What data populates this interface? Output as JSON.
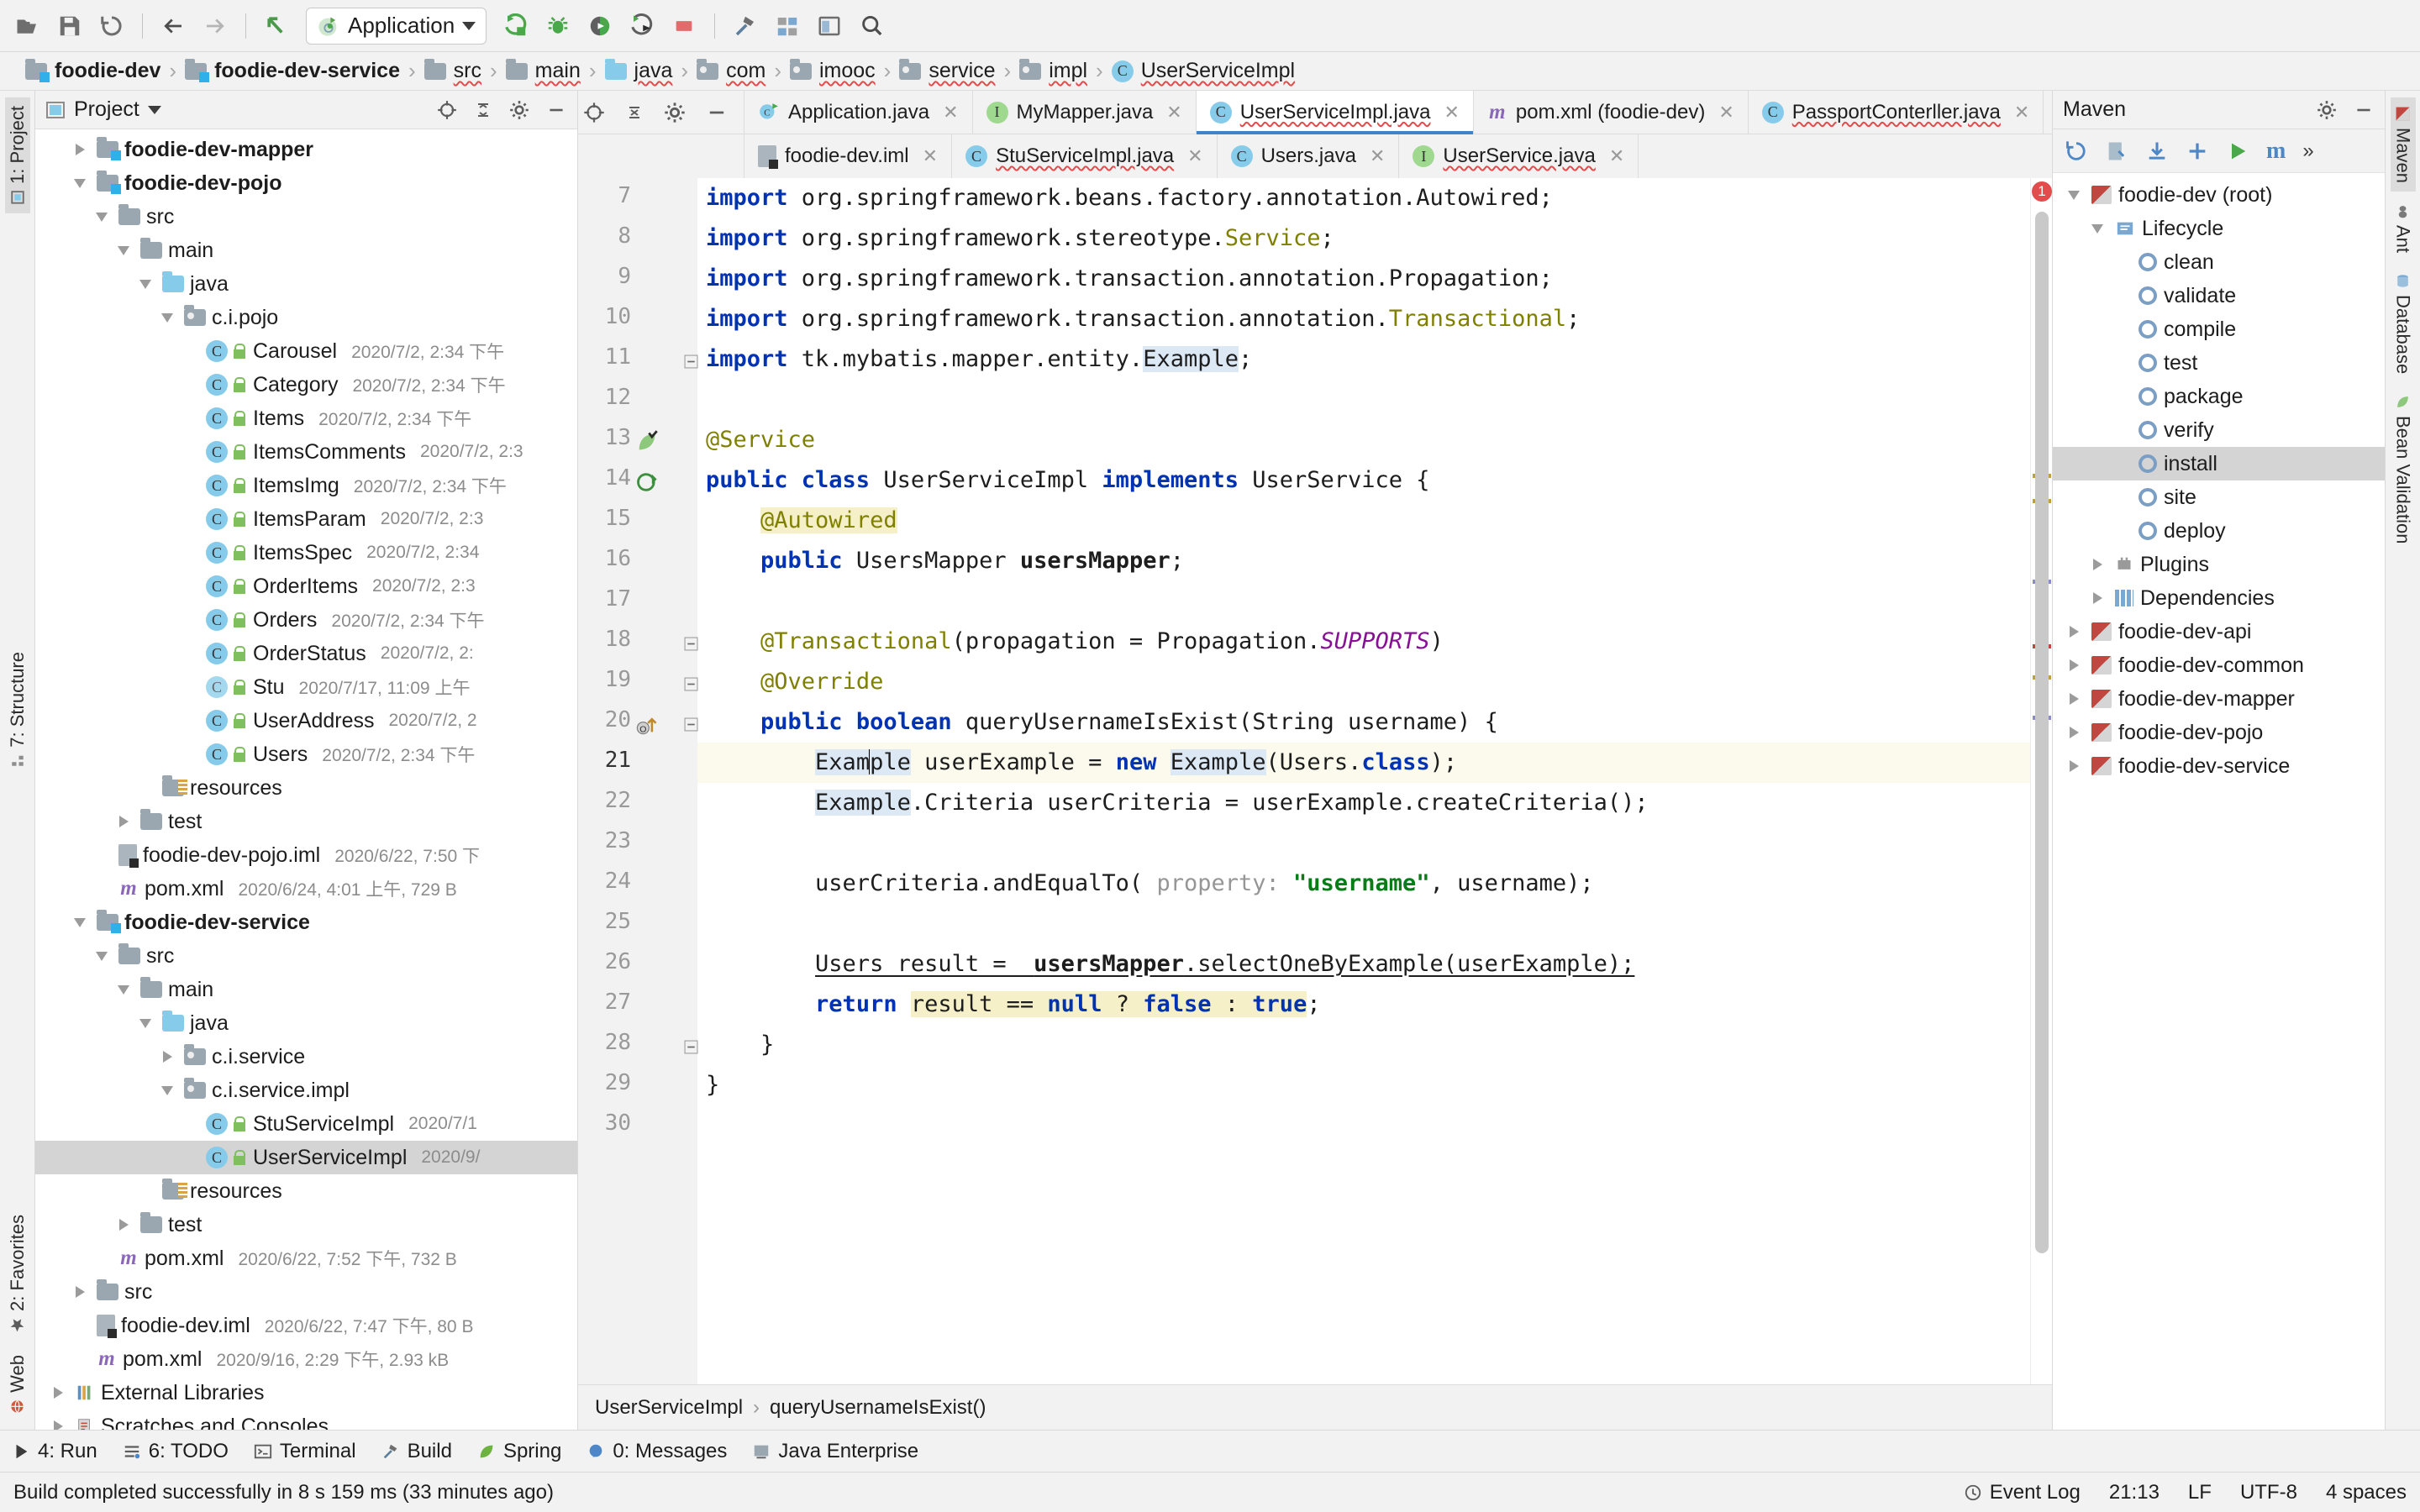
{
  "toolbar": {
    "buttons": [
      "open-folder",
      "save-all",
      "sync",
      "back",
      "forward",
      "jump-to-source"
    ],
    "run_config": {
      "label": "Application",
      "dropdown": "▾"
    },
    "right_buttons": [
      "run",
      "debug",
      "run-with-coverage",
      "profile",
      "stop",
      "build",
      "settings",
      "structure",
      "preview",
      "search"
    ]
  },
  "breadcrumb": {
    "items": [
      {
        "label": "foodie-dev",
        "icon": "module-folder-icon",
        "bold": true,
        "spell": false
      },
      {
        "label": "foodie-dev-service",
        "icon": "module-folder-icon",
        "bold": true,
        "spell": false
      },
      {
        "label": "src",
        "icon": "folder-icon",
        "bold": false,
        "spell": true
      },
      {
        "label": "main",
        "icon": "folder-icon",
        "bold": false,
        "spell": true
      },
      {
        "label": "java",
        "icon": "source-folder-icon",
        "bold": false,
        "spell": true
      },
      {
        "label": "com",
        "icon": "package-icon",
        "bold": false,
        "spell": true
      },
      {
        "label": "imooc",
        "icon": "package-icon",
        "bold": false,
        "spell": true
      },
      {
        "label": "service",
        "icon": "package-icon",
        "bold": false,
        "spell": true
      },
      {
        "label": "impl",
        "icon": "package-icon",
        "bold": false,
        "spell": true
      },
      {
        "label": "UserServiceImpl",
        "icon": "class-icon",
        "bold": false,
        "spell": true
      }
    ],
    "separator": "›"
  },
  "left_rail": {
    "top": [
      {
        "label": "1: Project",
        "icon": "project-icon",
        "selected": true
      }
    ],
    "middle": [
      {
        "label": "7: Structure",
        "icon": "structure-icon",
        "selected": false
      }
    ],
    "bottom": [
      {
        "label": "2: Favorites",
        "icon": "star-icon",
        "selected": false
      },
      {
        "label": "Web",
        "icon": "web-icon",
        "selected": false
      }
    ]
  },
  "project_panel": {
    "title": "Project",
    "dropdown": "▾",
    "header_icons": [
      "locate-icon",
      "collapse-all-icon",
      "settings-icon",
      "hide-icon"
    ],
    "tree": [
      {
        "indent": 1,
        "tw": "right",
        "icon": "module-folder-icon",
        "label": "foodie-dev-mapper",
        "bold": true,
        "meta": "",
        "sel": false
      },
      {
        "indent": 1,
        "tw": "down",
        "icon": "module-folder-icon",
        "label": "foodie-dev-pojo",
        "bold": true,
        "meta": "",
        "sel": false
      },
      {
        "indent": 2,
        "tw": "down",
        "icon": "folder-icon",
        "label": "src",
        "bold": false,
        "meta": "",
        "sel": false
      },
      {
        "indent": 3,
        "tw": "down",
        "icon": "folder-icon",
        "label": "main",
        "bold": false,
        "meta": "",
        "sel": false
      },
      {
        "indent": 4,
        "tw": "down",
        "icon": "source-folder-icon",
        "label": "java",
        "bold": false,
        "meta": "",
        "sel": false
      },
      {
        "indent": 5,
        "tw": "down",
        "icon": "package-icon",
        "label": "c.i.pojo",
        "bold": false,
        "meta": "",
        "sel": false
      },
      {
        "indent": 6,
        "tw": "none",
        "icon": "class-icon",
        "lock": true,
        "label": "Carousel",
        "bold": false,
        "meta": "2020/7/2, 2:34 下午",
        "sel": false
      },
      {
        "indent": 6,
        "tw": "none",
        "icon": "class-icon",
        "lock": true,
        "label": "Category",
        "bold": false,
        "meta": "2020/7/2, 2:34 下午",
        "sel": false
      },
      {
        "indent": 6,
        "tw": "none",
        "icon": "class-icon",
        "lock": true,
        "label": "Items",
        "bold": false,
        "meta": "2020/7/2, 2:34 下午",
        "sel": false
      },
      {
        "indent": 6,
        "tw": "none",
        "icon": "class-icon",
        "lock": true,
        "label": "ItemsComments",
        "bold": false,
        "meta": "2020/7/2, 2:3",
        "sel": false
      },
      {
        "indent": 6,
        "tw": "none",
        "icon": "class-icon",
        "lock": true,
        "label": "ItemsImg",
        "bold": false,
        "meta": "2020/7/2, 2:34 下午",
        "sel": false
      },
      {
        "indent": 6,
        "tw": "none",
        "icon": "class-icon",
        "lock": true,
        "label": "ItemsParam",
        "bold": false,
        "meta": "2020/7/2, 2:3",
        "sel": false
      },
      {
        "indent": 6,
        "tw": "none",
        "icon": "class-icon",
        "lock": true,
        "label": "ItemsSpec",
        "bold": false,
        "meta": "2020/7/2, 2:34",
        "sel": false
      },
      {
        "indent": 6,
        "tw": "none",
        "icon": "class-icon",
        "lock": true,
        "label": "OrderItems",
        "bold": false,
        "meta": "2020/7/2, 2:3",
        "sel": false
      },
      {
        "indent": 6,
        "tw": "none",
        "icon": "class-icon",
        "lock": true,
        "label": "Orders",
        "bold": false,
        "meta": "2020/7/2, 2:34 下午",
        "sel": false
      },
      {
        "indent": 6,
        "tw": "none",
        "icon": "class-icon",
        "lock": true,
        "label": "OrderStatus",
        "bold": false,
        "meta": "2020/7/2, 2:",
        "sel": false
      },
      {
        "indent": 6,
        "tw": "none",
        "icon": "abstract-class-icon",
        "lock": true,
        "label": "Stu",
        "bold": false,
        "meta": "2020/7/17, 11:09 上午",
        "sel": false
      },
      {
        "indent": 6,
        "tw": "none",
        "icon": "class-icon",
        "lock": true,
        "label": "UserAddress",
        "bold": false,
        "meta": "2020/7/2, 2",
        "sel": false
      },
      {
        "indent": 6,
        "tw": "none",
        "icon": "class-icon",
        "lock": true,
        "label": "Users",
        "bold": false,
        "meta": "2020/7/2, 2:34 下午",
        "sel": false
      },
      {
        "indent": 4,
        "tw": "none",
        "icon": "resources-folder-icon",
        "label": "resources",
        "bold": false,
        "meta": "",
        "sel": false
      },
      {
        "indent": 3,
        "tw": "right",
        "icon": "folder-icon",
        "label": "test",
        "bold": false,
        "meta": "",
        "sel": false
      },
      {
        "indent": 2,
        "tw": "none",
        "icon": "iml-file-icon",
        "label": "foodie-dev-pojo.iml",
        "bold": false,
        "meta": "2020/6/22, 7:50 下",
        "sel": false
      },
      {
        "indent": 2,
        "tw": "none",
        "icon": "maven-file-icon",
        "label": "pom.xml",
        "bold": false,
        "meta": "2020/6/24, 4:01 上午, 729 B",
        "sel": false
      },
      {
        "indent": 1,
        "tw": "down",
        "icon": "module-folder-icon",
        "label": "foodie-dev-service",
        "bold": true,
        "meta": "",
        "sel": false
      },
      {
        "indent": 2,
        "tw": "down",
        "icon": "folder-icon",
        "label": "src",
        "bold": false,
        "meta": "",
        "sel": false
      },
      {
        "indent": 3,
        "tw": "down",
        "icon": "folder-icon",
        "label": "main",
        "bold": false,
        "meta": "",
        "sel": false
      },
      {
        "indent": 4,
        "tw": "down",
        "icon": "source-folder-icon",
        "label": "java",
        "bold": false,
        "meta": "",
        "sel": false
      },
      {
        "indent": 5,
        "tw": "right",
        "icon": "package-icon",
        "label": "c.i.service",
        "bold": false,
        "meta": "",
        "sel": false
      },
      {
        "indent": 5,
        "tw": "down",
        "icon": "package-icon",
        "label": "c.i.service.impl",
        "bold": false,
        "meta": "",
        "sel": false
      },
      {
        "indent": 6,
        "tw": "none",
        "icon": "class-icon",
        "lock": true,
        "label": "StuServiceImpl",
        "bold": false,
        "meta": "2020/7/1",
        "sel": false
      },
      {
        "indent": 6,
        "tw": "none",
        "icon": "class-icon",
        "lock": true,
        "label": "UserServiceImpl",
        "bold": false,
        "meta": "2020/9/",
        "sel": true
      },
      {
        "indent": 4,
        "tw": "none",
        "icon": "resources-folder-icon",
        "label": "resources",
        "bold": false,
        "meta": "",
        "sel": false
      },
      {
        "indent": 3,
        "tw": "right",
        "icon": "folder-icon",
        "label": "test",
        "bold": false,
        "meta": "",
        "sel": false
      },
      {
        "indent": 2,
        "tw": "none",
        "icon": "maven-file-icon",
        "label": "pom.xml",
        "bold": false,
        "meta": "2020/6/22, 7:52 下午, 732 B",
        "sel": false
      },
      {
        "indent": 1,
        "tw": "right",
        "icon": "folder-icon",
        "label": "src",
        "bold": false,
        "meta": "",
        "sel": false
      },
      {
        "indent": 1,
        "tw": "none",
        "icon": "iml-file-icon",
        "label": "foodie-dev.iml",
        "bold": false,
        "meta": "2020/6/22, 7:47 下午, 80 B",
        "sel": false
      },
      {
        "indent": 1,
        "tw": "none",
        "icon": "maven-file-icon",
        "label": "pom.xml",
        "bold": false,
        "meta": "2020/9/16, 2:29 下午, 2.93 kB",
        "sel": false
      },
      {
        "indent": 0,
        "tw": "right",
        "icon": "library-icon",
        "label": "External Libraries",
        "bold": false,
        "meta": "",
        "sel": false
      },
      {
        "indent": 0,
        "tw": "right",
        "icon": "scratch-icon",
        "label": "Scratches and Consoles",
        "bold": false,
        "meta": "",
        "sel": false
      }
    ]
  },
  "editor": {
    "side_icons": [
      "locate-icon",
      "expand-collapse-icon",
      "settings-icon",
      "hide-icon"
    ],
    "tabs_row1": [
      {
        "label": "Application.java",
        "icon": "runnable-class-icon",
        "active": false,
        "close": "✕",
        "spell": false
      },
      {
        "label": "MyMapper.java",
        "icon": "interface-icon",
        "active": false,
        "close": "✕",
        "spell": false
      },
      {
        "label": "UserServiceImpl.java",
        "icon": "class-icon",
        "active": true,
        "close": "✕",
        "spell": true
      },
      {
        "label": "pom.xml (foodie-dev)",
        "icon": "maven-file-icon",
        "active": false,
        "close": "✕",
        "spell": false
      },
      {
        "label": "PassportConterller.java",
        "icon": "class-icon",
        "active": false,
        "close": "✕",
        "spell": true
      }
    ],
    "tabs_row2": [
      {
        "label": "foodie-dev.iml",
        "icon": "iml-file-icon",
        "active": false,
        "close": "✕",
        "spell": false
      },
      {
        "label": "StuServiceImpl.java",
        "icon": "class-icon",
        "active": false,
        "close": "✕",
        "spell": true
      },
      {
        "label": "Users.java",
        "icon": "class-icon",
        "active": false,
        "close": "✕",
        "spell": false
      },
      {
        "label": "UserService.java",
        "icon": "interface-icon",
        "active": false,
        "close": "✕",
        "spell": true
      }
    ],
    "lines": [
      {
        "n": 7,
        "fold": "",
        "gicon": "",
        "hl": false
      },
      {
        "n": 8,
        "fold": "",
        "gicon": "",
        "hl": false
      },
      {
        "n": 9,
        "fold": "",
        "gicon": "",
        "hl": false
      },
      {
        "n": 10,
        "fold": "",
        "gicon": "",
        "hl": false
      },
      {
        "n": 11,
        "fold": "-",
        "gicon": "",
        "hl": false
      },
      {
        "n": 12,
        "fold": "",
        "gicon": "",
        "hl": false
      },
      {
        "n": 13,
        "fold": "",
        "gicon": "bean-icon",
        "hl": false
      },
      {
        "n": 14,
        "fold": "",
        "gicon": "impl-icon",
        "hl": false
      },
      {
        "n": 15,
        "fold": "",
        "gicon": "",
        "hl": false
      },
      {
        "n": 16,
        "fold": "",
        "gicon": "",
        "hl": false
      },
      {
        "n": 17,
        "fold": "",
        "gicon": "",
        "hl": false
      },
      {
        "n": 18,
        "fold": "-",
        "gicon": "",
        "hl": false
      },
      {
        "n": 19,
        "fold": "-",
        "gicon": "",
        "hl": false
      },
      {
        "n": 20,
        "fold": "-",
        "gicon": "override-icon",
        "hl": false
      },
      {
        "n": 21,
        "fold": "",
        "gicon": "",
        "hl": true
      },
      {
        "n": 22,
        "fold": "",
        "gicon": "",
        "hl": false
      },
      {
        "n": 23,
        "fold": "",
        "gicon": "",
        "hl": false
      },
      {
        "n": 24,
        "fold": "",
        "gicon": "",
        "hl": false
      },
      {
        "n": 25,
        "fold": "",
        "gicon": "",
        "hl": false
      },
      {
        "n": 26,
        "fold": "",
        "gicon": "",
        "hl": false
      },
      {
        "n": 27,
        "fold": "",
        "gicon": "",
        "hl": false
      },
      {
        "n": 28,
        "fold": "-",
        "gicon": "",
        "hl": false
      },
      {
        "n": 29,
        "fold": "",
        "gicon": "",
        "hl": false
      },
      {
        "n": 30,
        "fold": "",
        "gicon": "",
        "hl": false
      }
    ],
    "source_text": [
      "import org.springframework.beans.factory.annotation.Autowired;",
      "import org.springframework.stereotype.Service;",
      "import org.springframework.transaction.annotation.Propagation;",
      "import org.springframework.transaction.annotation.Transactional;",
      "import tk.mybatis.mapper.entity.Example;",
      "",
      "@Service",
      "public class UserServiceImpl implements UserService {",
      "    @Autowired",
      "    public UsersMapper usersMapper;",
      "",
      "    @Transactional(propagation = Propagation.SUPPORTS)",
      "    @Override",
      "    public boolean queryUsernameIsExist(String username) {",
      "        Example userExample = new Example(Users.class);",
      "        Example.Criteria userCriteria = userExample.createCriteria();",
      "",
      "        userCriteria.andEqualTo( property: \"username\", username);",
      "",
      "        Users result =  usersMapper.selectOneByExample(userExample);",
      "        return result == null ? false : true;",
      "    }",
      "}",
      ""
    ],
    "error_count": "1",
    "bottom_breadcrumb": [
      "UserServiceImpl",
      "queryUsernameIsExist()"
    ],
    "bottom_breadcrumb_sep": "›"
  },
  "maven": {
    "title": "Maven",
    "header_icons": [
      "settings-icon",
      "hide-icon"
    ],
    "toolbar_icons": [
      "reimport-icon",
      "generate-sources-icon",
      "download-sources-icon",
      "add-icon",
      "run-icon",
      "execute-maven-goal-icon",
      "more-icon"
    ],
    "tree": [
      {
        "indent": 0,
        "tw": "down",
        "icon": "maven-project-icon",
        "label": "foodie-dev (root)",
        "sel": false
      },
      {
        "indent": 1,
        "tw": "down",
        "icon": "lifecycle-icon",
        "label": "Lifecycle",
        "sel": false
      },
      {
        "indent": 2,
        "tw": "none",
        "icon": "goal-icon",
        "label": "clean",
        "sel": false
      },
      {
        "indent": 2,
        "tw": "none",
        "icon": "goal-icon",
        "label": "validate",
        "sel": false
      },
      {
        "indent": 2,
        "tw": "none",
        "icon": "goal-icon",
        "label": "compile",
        "sel": false
      },
      {
        "indent": 2,
        "tw": "none",
        "icon": "goal-icon",
        "label": "test",
        "sel": false
      },
      {
        "indent": 2,
        "tw": "none",
        "icon": "goal-icon",
        "label": "package",
        "sel": false
      },
      {
        "indent": 2,
        "tw": "none",
        "icon": "goal-icon",
        "label": "verify",
        "sel": false
      },
      {
        "indent": 2,
        "tw": "none",
        "icon": "goal-icon",
        "label": "install",
        "sel": true
      },
      {
        "indent": 2,
        "tw": "none",
        "icon": "goal-icon",
        "label": "site",
        "sel": false
      },
      {
        "indent": 2,
        "tw": "none",
        "icon": "goal-icon",
        "label": "deploy",
        "sel": false
      },
      {
        "indent": 1,
        "tw": "right",
        "icon": "plugins-icon",
        "label": "Plugins",
        "sel": false
      },
      {
        "indent": 1,
        "tw": "right",
        "icon": "dependencies-icon",
        "label": "Dependencies",
        "sel": false
      },
      {
        "indent": 0,
        "tw": "right",
        "icon": "maven-project-icon",
        "label": "foodie-dev-api",
        "sel": false
      },
      {
        "indent": 0,
        "tw": "right",
        "icon": "maven-project-icon",
        "label": "foodie-dev-common",
        "sel": false
      },
      {
        "indent": 0,
        "tw": "right",
        "icon": "maven-project-icon",
        "label": "foodie-dev-mapper",
        "sel": false
      },
      {
        "indent": 0,
        "tw": "right",
        "icon": "maven-project-icon",
        "label": "foodie-dev-pojo",
        "sel": false
      },
      {
        "indent": 0,
        "tw": "right",
        "icon": "maven-project-icon",
        "label": "foodie-dev-service",
        "sel": false
      }
    ]
  },
  "right_rail": [
    {
      "label": "Maven",
      "icon": "maven-icon",
      "selected": true
    },
    {
      "label": "Ant",
      "icon": "ant-icon",
      "selected": false
    },
    {
      "label": "Database",
      "icon": "database-icon",
      "selected": false
    },
    {
      "label": "Bean Validation",
      "icon": "bean-validation-icon",
      "selected": false
    }
  ],
  "tool_windows": [
    {
      "label": "4: Run",
      "icon": "run-icon"
    },
    {
      "label": "6: TODO",
      "icon": "todo-icon"
    },
    {
      "label": "Terminal",
      "icon": "terminal-icon"
    },
    {
      "label": "Build",
      "icon": "build-icon"
    },
    {
      "label": "Spring",
      "icon": "spring-icon"
    },
    {
      "label": "0: Messages",
      "icon": "messages-icon"
    },
    {
      "label": "Java Enterprise",
      "icon": "java-enterprise-icon"
    }
  ],
  "status_bar": {
    "message": "Build completed successfully in 8 s 159 ms (33 minutes ago)",
    "event_log": "Event Log",
    "position": "21:13",
    "line_sep": "LF",
    "encoding": "UTF-8",
    "indent": "4 spaces"
  },
  "colors": {
    "accent": "#4083c9",
    "keyword": "#0033b3",
    "annotation": "#808000",
    "string": "#067d17",
    "static_field": "#871094",
    "error": "#e24c4c",
    "selection": "#dde8f5",
    "highlight_line": "#fcfaed",
    "panel_bg": "#f2f2f2",
    "sel_bg": "#d4d4d4"
  }
}
